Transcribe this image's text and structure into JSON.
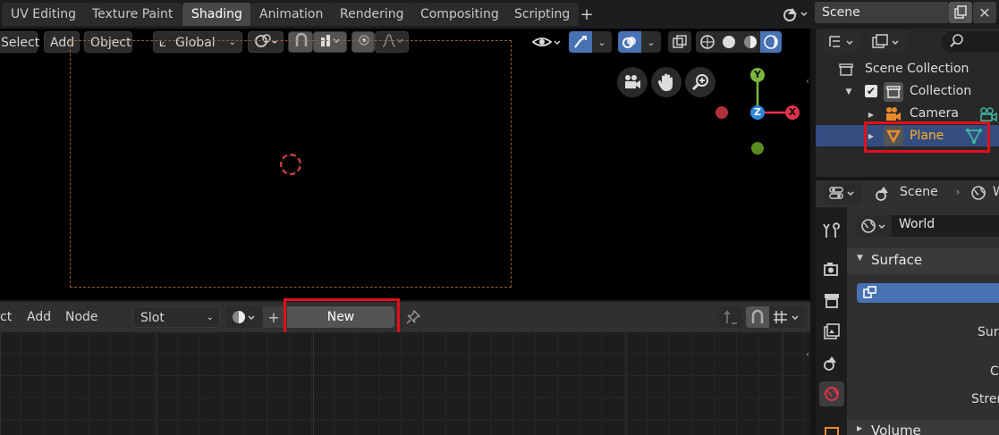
{
  "workspace_tabs": [
    "UV Editing",
    "Texture Paint",
    "Shading",
    "Animation",
    "Rendering",
    "Compositing",
    "Scripting"
  ],
  "scene_field": "Scene",
  "viewport_header": {
    "select": "Select",
    "add": "Add",
    "object": "Object",
    "transform_orientation": "Global"
  },
  "gizmo": {
    "y": "Y",
    "z": "Z",
    "x": "X"
  },
  "node_header": {
    "select_partial": "ct",
    "add": "Add",
    "node": "Node",
    "slot": "Slot",
    "new_button": "New"
  },
  "outliner": {
    "scene_collection": "Scene Collection",
    "collection": "Collection",
    "camera": "Camera",
    "plane": "Plane"
  },
  "properties": {
    "scene_label": "Scene",
    "world_tab_partial": "W",
    "world_name": "World",
    "surface_panel": "Surface",
    "surface_label_partial": "Surf",
    "color_label_partial": "C",
    "strength_label_partial": "Stren",
    "volume_panel": "Volume"
  },
  "colors": {
    "accent_blue": "#4772b3",
    "highlight_red": "#e0101a",
    "plane_orange": "#e88c2c",
    "gizmo_x": "#e0334a",
    "gizmo_y": "#7ab83c",
    "gizmo_z": "#2f86db"
  }
}
